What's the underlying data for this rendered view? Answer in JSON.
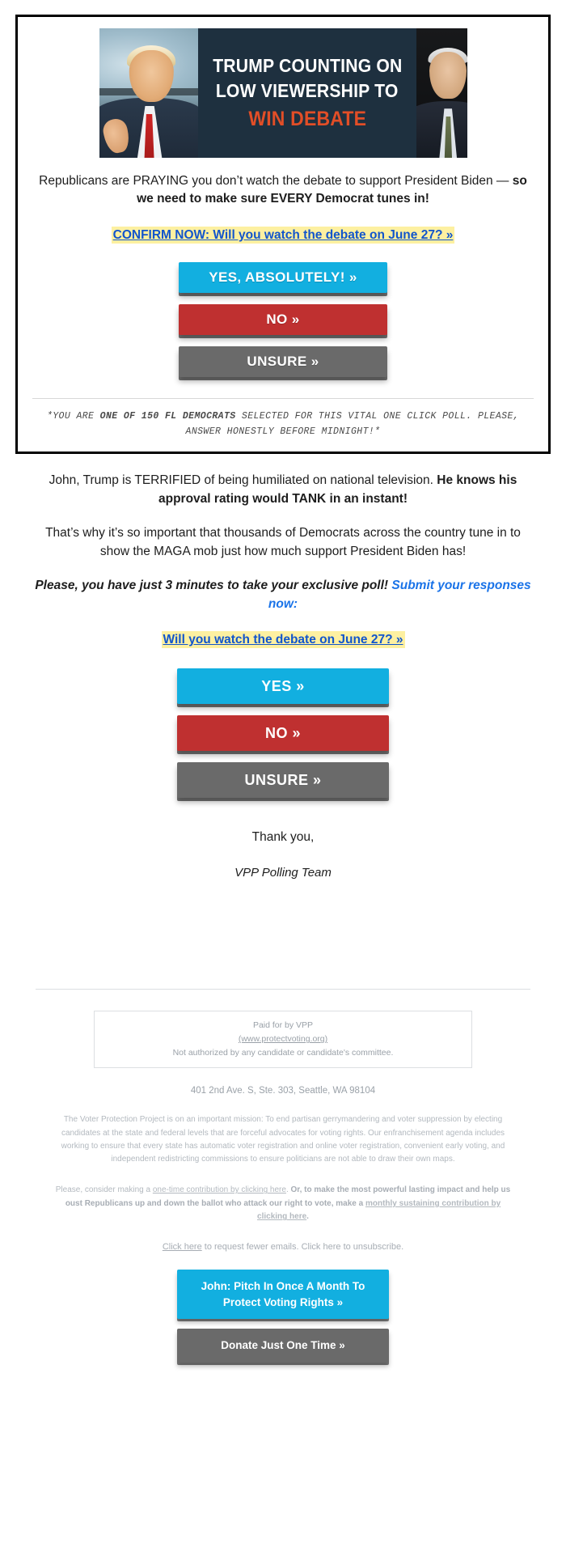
{
  "banner": {
    "line1": "TRUMP COUNTING ON",
    "line2": "LOW VIEWERSHIP TO",
    "line3": "WIN DEBATE",
    "bg_color": "#1e303f",
    "accent_color": "#e24e27",
    "left_photo_alt": "trump-thumbs-up-photo",
    "right_photo_alt": "biden-speaking-photo"
  },
  "poll_box": {
    "intro_part1": "Republicans are PRAYING you don’t watch the debate to support President Biden — ",
    "intro_bold": "so we need to make sure EVERY Democrat tunes in!",
    "confirm_link": "CONFIRM NOW: Will you watch the debate on June 27? »",
    "buttons": [
      {
        "label": "YES, ABSOLUTELY! »",
        "color": "#12afe0",
        "name": "poll-yes-button"
      },
      {
        "label": "NO »",
        "color": "#bf3030",
        "name": "poll-no-button"
      },
      {
        "label": "UNSURE »",
        "color": "#6a6a6a",
        "name": "poll-unsure-button"
      }
    ],
    "fineprint_pre": "*YOU ARE ",
    "fineprint_bold": "ONE OF 150 FL DEMOCRATS",
    "fineprint_post": " SELECTED FOR THIS VITAL ONE CLICK POLL. PLEASE, ANSWER HONESTLY BEFORE MIDNIGHT!*"
  },
  "body": {
    "para1_part1": "John, Trump is TERRIFIED of being humiliated on national television. ",
    "para1_bold": "He knows his approval rating would TANK in an instant!",
    "para2": "That’s why it’s so important that thousands of Democrats across the country tune in to show the MAGA mob just how much support President Biden has!",
    "para3_emph": "Please, you have just 3 minutes to take your exclusive poll! ",
    "para3_link": "Submit your responses now:",
    "confirm_link2": "Will you watch the debate on June 27? »",
    "buttons": [
      {
        "label": "YES »",
        "color": "#12afe0",
        "name": "poll2-yes-button"
      },
      {
        "label": "NO »",
        "color": "#bf3030",
        "name": "poll2-no-button"
      },
      {
        "label": "UNSURE »",
        "color": "#6a6a6a",
        "name": "poll2-unsure-button"
      }
    ],
    "thanks": "Thank you,",
    "team": "VPP Polling Team"
  },
  "footer": {
    "paid_line1": "Paid for by VPP",
    "paid_link": "(www.protectvoting.org)",
    "paid_line3": "Not authorized by any candidate or candidate's committee.",
    "address": "401 2nd Ave. S, Ste. 303, Seattle, WA 98104",
    "mission": "The Voter Protection Project is on an important mission: To end partisan gerrymandering and voter suppression by electing candidates at the state and federal levels that are forceful advocates for voting rights. Our enfranchisement agenda includes working to ensure that every state has automatic voter registration and online voter registration, convenient early voting, and independent redistricting commissions to ensure politicians are not able to draw their own maps.",
    "contrib_pre": "Please, consider making a ",
    "contrib_link1": "one-time contribution by clicking here",
    "contrib_mid": ". ",
    "contrib_bold1": "Or, to make the most powerful lasting impact and help us oust Republicans up and down the ballot who attack our right to vote, make a ",
    "contrib_link2": "monthly sustaining contribution by clicking here",
    "contrib_end": ".",
    "unsub_link": "Click here",
    "unsub_rest": " to request fewer emails. Click here to unsubscribe.",
    "donate_primary": "John: Pitch In Once A Month To Protect Voting Rights »",
    "donate_secondary": "Donate Just One Time »"
  }
}
